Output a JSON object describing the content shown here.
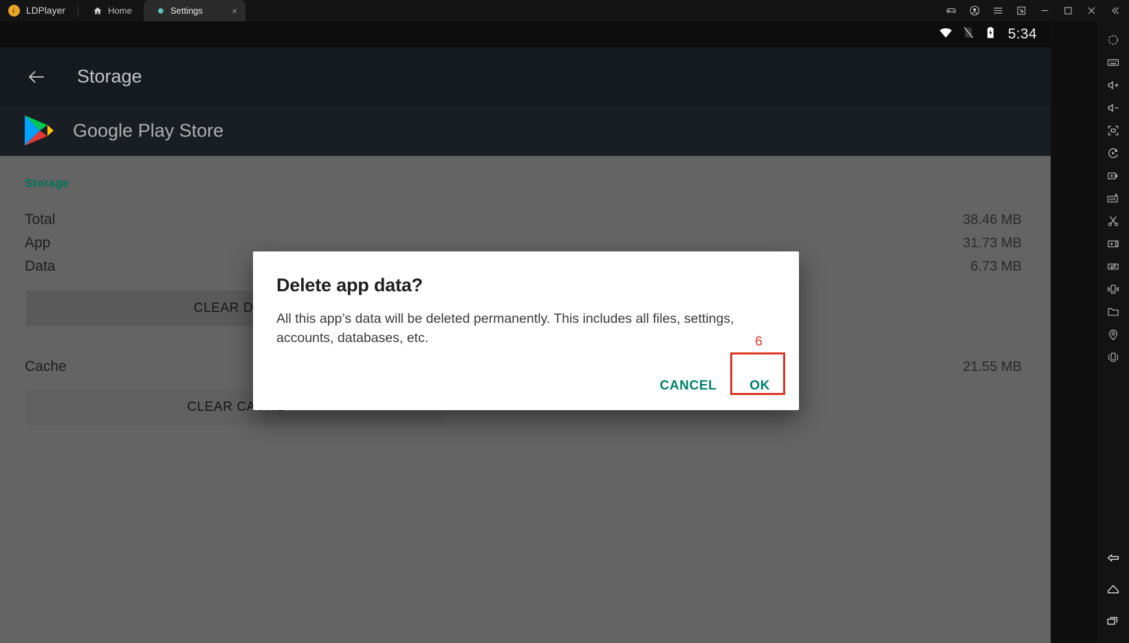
{
  "titlebar": {
    "brand": "LDPlayer",
    "tabs": [
      {
        "label": "Home",
        "icon": "home-icon",
        "active": false
      },
      {
        "label": "Settings",
        "icon": "gear-icon",
        "active": true,
        "close": "×"
      }
    ],
    "controls": [
      {
        "name": "gamepad-icon"
      },
      {
        "name": "account-icon"
      },
      {
        "name": "menu-icon"
      },
      {
        "name": "resize-icon"
      },
      {
        "name": "minimize-icon"
      },
      {
        "name": "maximize-icon"
      },
      {
        "name": "close-icon"
      },
      {
        "name": "collapse-icon"
      }
    ]
  },
  "statusbar": {
    "wifi": "wifi-icon",
    "signal": "no-sim-icon",
    "battery": "battery-charging-icon",
    "clock": "5:34"
  },
  "appbar": {
    "back": "back-arrow-icon",
    "title": "Storage"
  },
  "appheader": {
    "icon": "google-play-icon",
    "title": "Google Play Store"
  },
  "storage": {
    "section_title": "Storage",
    "rows": [
      {
        "label": "Total",
        "value": "38.46 MB"
      },
      {
        "label": "App",
        "value": "31.73 MB"
      },
      {
        "label": "Data",
        "value": "6.73 MB"
      }
    ],
    "clear_data_label": "CLEAR DATA",
    "cache_label": "Cache",
    "cache_value": "21.55 MB",
    "clear_cache_label": "CLEAR CACHE"
  },
  "dialog": {
    "title": "Delete app data?",
    "body": "All this app’s data will be deleted permanently. This includes all files, settings, accounts, databases, etc.",
    "cancel_label": "CANCEL",
    "ok_label": "OK",
    "annotation_number": "6"
  },
  "sidebar": {
    "top_icons": [
      {
        "name": "rotate-screen-icon"
      },
      {
        "name": "keyboard-icon"
      },
      {
        "name": "volume-up-icon"
      },
      {
        "name": "volume-down-icon"
      },
      {
        "name": "fullscreen-icon"
      },
      {
        "name": "macro-play-icon"
      },
      {
        "name": "multi-instance-icon"
      },
      {
        "name": "install-apk-icon"
      },
      {
        "name": "screenshot-icon"
      },
      {
        "name": "video-record-icon"
      },
      {
        "name": "file-transfer-icon"
      },
      {
        "name": "shake-icon"
      },
      {
        "name": "folder-icon"
      },
      {
        "name": "location-icon"
      },
      {
        "name": "rotate-device-icon"
      }
    ],
    "bottom_icons": [
      {
        "name": "nav-back-icon"
      },
      {
        "name": "nav-home-icon"
      },
      {
        "name": "nav-recents-icon"
      }
    ]
  },
  "colors": {
    "accent_teal": "#00806b",
    "annotation_red": "#dd3520",
    "content_bg": "#646464",
    "dialog_bg": "#ffffff"
  }
}
